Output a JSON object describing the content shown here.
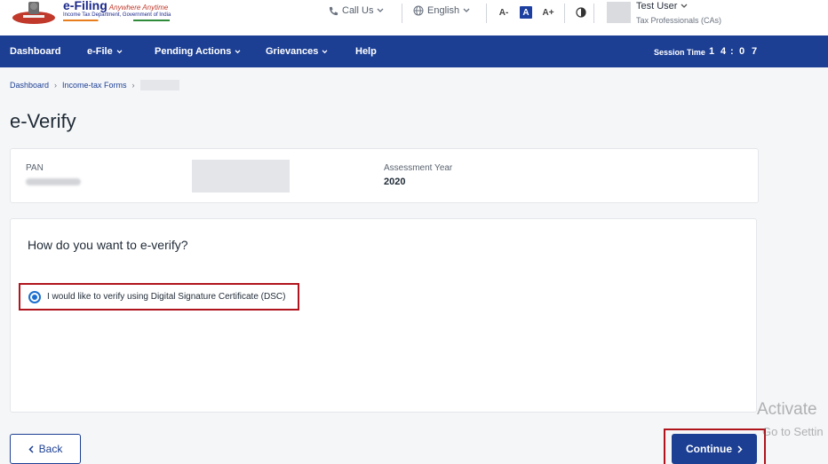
{
  "header": {
    "logo": {
      "title": "e-Filing",
      "tagline": "Anywhere Anytime",
      "subtitle": "Income Tax Department, Government of India"
    },
    "call_us_label": "Call Us",
    "language_label": "English",
    "font_controls": [
      "A-",
      "A",
      "A+"
    ],
    "contrast_icon": "contrast-icon",
    "user": {
      "name": "Test User",
      "role": "Tax Professionals (CAs)"
    }
  },
  "nav": {
    "items": [
      {
        "label": "Dashboard",
        "has_dropdown": false
      },
      {
        "label": "e-File",
        "has_dropdown": true
      },
      {
        "label": "Pending Actions",
        "has_dropdown": true
      },
      {
        "label": "Grievances",
        "has_dropdown": true
      },
      {
        "label": "Help",
        "has_dropdown": false
      }
    ],
    "session_label": "Session Time",
    "session_digits": [
      "1",
      "4",
      ":",
      "0",
      "7"
    ]
  },
  "breadcrumb": {
    "items": [
      "Dashboard",
      "Income-tax Forms"
    ]
  },
  "page_title": "e-Verify",
  "info_card": {
    "pan_label": "PAN",
    "assessment_year_label": "Assessment Year",
    "assessment_year_value": "2020"
  },
  "verify_card": {
    "question": "How do you want to e-verify?",
    "options": [
      {
        "label": "I would like to verify using Digital Signature Certificate (DSC)",
        "selected": true
      }
    ]
  },
  "buttons": {
    "back_label": "Back",
    "continue_label": "Continue"
  },
  "watermark": {
    "title": "Activate",
    "subtitle": "Go to Settin"
  },
  "colors": {
    "nav_bg": "#1c3f94",
    "highlight_red": "#b0141c",
    "radio_blue": "#1c6fd0"
  }
}
